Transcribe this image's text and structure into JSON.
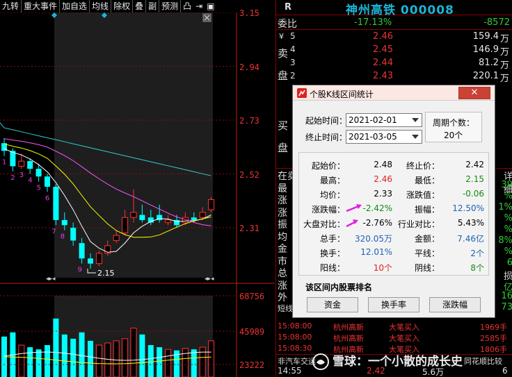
{
  "toolbar": {
    "items": [
      "九转",
      "重大事件",
      "加自选",
      "均线",
      "除权",
      "叠",
      "副",
      "预测",
      "凸",
      "⇥",
      "▣"
    ]
  },
  "chart": {
    "price_axis": [
      "3.15",
      "2.94",
      "2.73",
      "2.52",
      "2.31"
    ],
    "volume_axis": [
      "68756",
      "45989",
      "23222"
    ],
    "low_marker": "2.15",
    "td_counts_down": [
      "1",
      "2",
      "3",
      "4",
      "5",
      "6"
    ],
    "td_counts_up": [
      "7",
      "8",
      "9"
    ],
    "colors": {
      "up": "#ff3232",
      "down": "#00ffff",
      "ma5": "#ffffff",
      "ma10": "#ffff00",
      "ma20": "#ff55ff",
      "ma60": "#33cccc"
    },
    "candles": [
      {
        "o": 2.64,
        "c": 2.61,
        "h": 2.66,
        "l": 2.59
      },
      {
        "o": 2.61,
        "c": 2.55,
        "h": 2.62,
        "l": 2.53
      },
      {
        "o": 2.55,
        "c": 2.57,
        "h": 2.6,
        "l": 2.54
      },
      {
        "o": 2.57,
        "c": 2.54,
        "h": 2.58,
        "l": 2.52
      },
      {
        "o": 2.54,
        "c": 2.51,
        "h": 2.56,
        "l": 2.49
      },
      {
        "o": 2.51,
        "c": 2.47,
        "h": 2.52,
        "l": 2.45
      },
      {
        "o": 2.47,
        "c": 2.34,
        "h": 2.48,
        "l": 2.32
      },
      {
        "o": 2.34,
        "c": 2.32,
        "h": 2.37,
        "l": 2.3
      },
      {
        "o": 2.31,
        "c": 2.26,
        "h": 2.33,
        "l": 2.24
      },
      {
        "o": 2.25,
        "c": 2.19,
        "h": 2.27,
        "l": 2.17
      },
      {
        "o": 2.19,
        "c": 2.17,
        "h": 2.21,
        "l": 2.15
      },
      {
        "o": 2.17,
        "c": 2.21,
        "h": 2.22,
        "l": 2.16
      },
      {
        "o": 2.21,
        "c": 2.24,
        "h": 2.26,
        "l": 2.2
      },
      {
        "o": 2.26,
        "c": 2.28,
        "h": 2.3,
        "l": 2.25
      },
      {
        "o": 2.29,
        "c": 2.35,
        "h": 2.38,
        "l": 2.28
      },
      {
        "o": 2.35,
        "c": 2.37,
        "h": 2.46,
        "l": 2.33
      },
      {
        "o": 2.36,
        "c": 2.34,
        "h": 2.4,
        "l": 2.33
      },
      {
        "o": 2.35,
        "c": 2.33,
        "h": 2.38,
        "l": 2.32
      },
      {
        "o": 2.36,
        "c": 2.34,
        "h": 2.4,
        "l": 2.33
      },
      {
        "o": 2.33,
        "c": 2.34,
        "h": 2.36,
        "l": 2.32
      },
      {
        "o": 2.34,
        "c": 2.32,
        "h": 2.36,
        "l": 2.31
      },
      {
        "o": 2.33,
        "c": 2.35,
        "h": 2.37,
        "l": 2.32
      },
      {
        "o": 2.35,
        "c": 2.34,
        "h": 2.37,
        "l": 2.33
      },
      {
        "o": 2.35,
        "c": 2.37,
        "h": 2.39,
        "l": 2.34
      },
      {
        "o": 2.38,
        "c": 2.42,
        "h": 2.43,
        "l": 2.37
      }
    ],
    "volumes": [
      38,
      42,
      30,
      28,
      26,
      30,
      55,
      40,
      36,
      42,
      34,
      30,
      32,
      34,
      36,
      46,
      40,
      30,
      28,
      26,
      25,
      27,
      26,
      28,
      34
    ]
  },
  "quote": {
    "market": "R",
    "title": "神州高铁 000008",
    "weibi_label": "委比",
    "weibi_pct": "-17.13%",
    "weibi_diff": "-8572",
    "sell_side_chars": [
      "卖",
      "盘"
    ],
    "buy_side_chars": [
      "买",
      "盘"
    ],
    "sell_rows": [
      {
        "lbl": "5",
        "price": "2.46",
        "vol": "159.4",
        "unit": "万"
      },
      {
        "lbl": "4",
        "price": "2.45",
        "vol": "146.9",
        "unit": "万"
      },
      {
        "lbl": "3",
        "price": "2.44",
        "vol": "81.2",
        "unit": "万"
      },
      {
        "lbl": "2",
        "price": "2.43",
        "vol": "220.1",
        "unit": "万"
      }
    ],
    "left_labels": [
      "在卖",
      "最",
      "涨",
      "涨",
      "振",
      "均",
      "金",
      "市",
      "总",
      "涨",
      "外",
      "短线"
    ],
    "right_col": [
      "详细",
      "39",
      "%",
      "1%",
      "%",
      "%",
      "8%",
      "%",
      "6",
      "损",
      "亿",
      "16",
      "73"
    ],
    "ticks": [
      {
        "time": "15:08:00",
        "name": "杭州高新",
        "type": "大笔买入",
        "vol": "1969手"
      },
      {
        "time": "15:08:00",
        "name": "杭州高新",
        "type": "大笔买入",
        "vol": "2585手"
      },
      {
        "time": "15:08:30",
        "name": "杭州高新",
        "type": "大笔买入",
        "vol": "1806手"
      }
    ],
    "bottom_tab": "非汽车交运",
    "bottom_tab_right": "同花顺比较",
    "last_row": {
      "time": "14:55",
      "price": "2.42",
      "vol": "5.6万",
      "num": "6"
    }
  },
  "dialog": {
    "title": "个股K线区间统计",
    "close": "✕",
    "start_label": "起始时间：",
    "start_value": "2021-02-01",
    "end_label": "终止时间：",
    "end_value": "2021-03-05",
    "period_label": "周期个数：",
    "period_value": "20个",
    "stats": [
      {
        "l1": "起始价：",
        "v1": "2.48",
        "c1": "#000",
        "l2": "终止价：",
        "v2": "2.42",
        "c2": "#000"
      },
      {
        "l1": "最高：",
        "v1": "2.46",
        "c1": "#e02020",
        "l2": "最低：",
        "v2": "2.15",
        "c2": "#138a13"
      },
      {
        "l1": "均价：",
        "v1": "2.33",
        "c1": "#000",
        "l2": "涨跌值：",
        "v2": "-0.06",
        "c2": "#138a13"
      },
      {
        "l1": "涨跌幅：",
        "v1": "-2.42%",
        "c1": "#138a13",
        "l2": "振幅：",
        "v2": "12.50%",
        "c2": "#1a63b8"
      },
      {
        "l1": "大盘对比：",
        "v1": "-2.76%",
        "c1": "#000",
        "l2": "行业对比：",
        "v2": "5.43%",
        "c2": "#000"
      },
      {
        "l1": "总手：",
        "v1": "320.05万",
        "c1": "#1a63b8",
        "l2": "金额：",
        "v2": "7.46亿",
        "c2": "#1a63b8"
      },
      {
        "l1": "换手：",
        "v1": "12.01%",
        "c1": "#1a63b8",
        "l2": "平线：",
        "v2": "2个",
        "c2": "#1a63b8"
      },
      {
        "l1": "阳线：",
        "v1": "10个",
        "c1": "#e02020",
        "l2": "阴线：",
        "v2": "8个",
        "c2": "#138a13"
      }
    ],
    "rank_label": "该区间内股票排名",
    "buttons": [
      "资金",
      "换手率",
      "涨跌幅"
    ]
  },
  "watermark": "雪球：一个小散的成长史"
}
